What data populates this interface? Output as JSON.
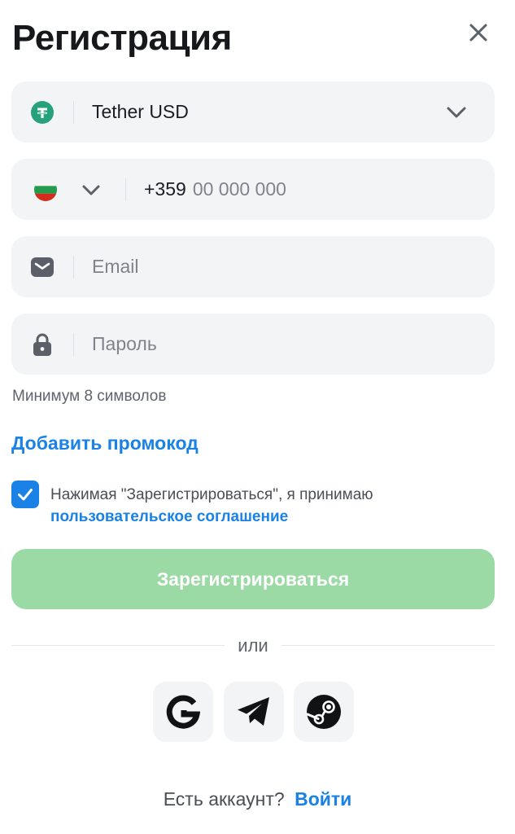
{
  "header": {
    "title": "Регистрация"
  },
  "currency": {
    "value": "Tether USD",
    "icon": "tether-icon"
  },
  "phone": {
    "code": "+359",
    "placeholder": "00 000 000",
    "flag": "bulgaria-flag-icon"
  },
  "email": {
    "placeholder": "Email"
  },
  "password": {
    "placeholder": "Пароль",
    "hint": "Минимум 8 символов"
  },
  "promo": {
    "label": "Добавить промокод"
  },
  "agreement": {
    "text": "Нажимая \"Зарегистрироваться\", я принимаю",
    "link": "пользовательское соглашение",
    "checked": true
  },
  "submit": {
    "label": "Зарегистрироваться"
  },
  "divider": {
    "label": "или"
  },
  "social": [
    {
      "icon": "google-icon"
    },
    {
      "icon": "telegram-icon"
    },
    {
      "icon": "steam-icon"
    }
  ],
  "footer": {
    "question": "Есть аккаунт?",
    "login": "Войти"
  },
  "colors": {
    "accent": "#1a82e6",
    "submit_disabled": "#9bd9a5",
    "field_bg": "#f3f4f6",
    "tether": "#26a17b"
  }
}
